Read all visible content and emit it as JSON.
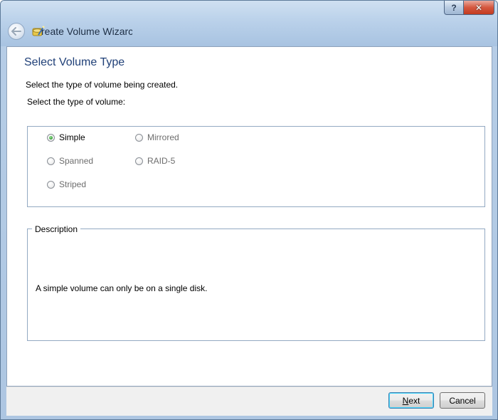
{
  "window": {
    "title": "Create Volume Wizard",
    "title_visible": "reate Volume Wizarc",
    "help_label": "?",
    "close_label": "✕"
  },
  "page": {
    "title": "Select Volume Type",
    "instruction_primary": "Select the type of volume being created.",
    "instruction_secondary": "Select the type of volume:"
  },
  "volume_types": [
    {
      "label": "Simple",
      "selected": true,
      "enabled": true
    },
    {
      "label": "Spanned",
      "selected": false,
      "enabled": false
    },
    {
      "label": "Striped",
      "selected": false,
      "enabled": false
    },
    {
      "label": "Mirrored",
      "selected": false,
      "enabled": false
    },
    {
      "label": "RAID-5",
      "selected": false,
      "enabled": false
    }
  ],
  "description": {
    "legend": "Description",
    "text": "A simple volume can only be on a single disk."
  },
  "buttons": {
    "next_label": "Next",
    "next_mnemonic": "N",
    "next_rest": "ext",
    "cancel_label": "Cancel"
  },
  "colors": {
    "title_blue": "#1f3f77",
    "frame": "#93a9c2",
    "selected_radio": "#2f9a2f"
  },
  "icons": [
    "back-arrow-icon",
    "wizard-icon",
    "help-icon",
    "close-icon"
  ]
}
